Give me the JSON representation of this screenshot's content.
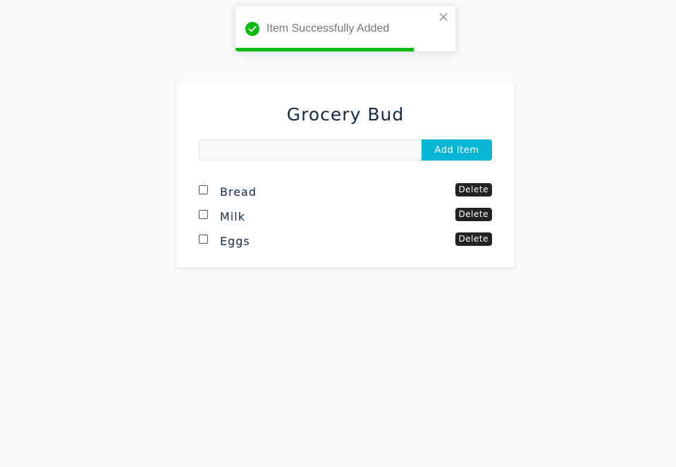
{
  "toast": {
    "message": "Item Successfully Added",
    "icon": "check-circle-icon",
    "close_icon": "close-icon",
    "progress": 0.81,
    "color": "#07bc0c"
  },
  "app": {
    "title": "Grocery Bud",
    "input": {
      "value": "",
      "placeholder": ""
    },
    "add_button_label": "Add Item",
    "accent_color": "#06b6d4",
    "items": [
      {
        "label": "Bread",
        "checked": false,
        "delete_label": "Delete"
      },
      {
        "label": "Milk",
        "checked": false,
        "delete_label": "Delete"
      },
      {
        "label": "Eggs",
        "checked": false,
        "delete_label": "Delete"
      }
    ]
  }
}
